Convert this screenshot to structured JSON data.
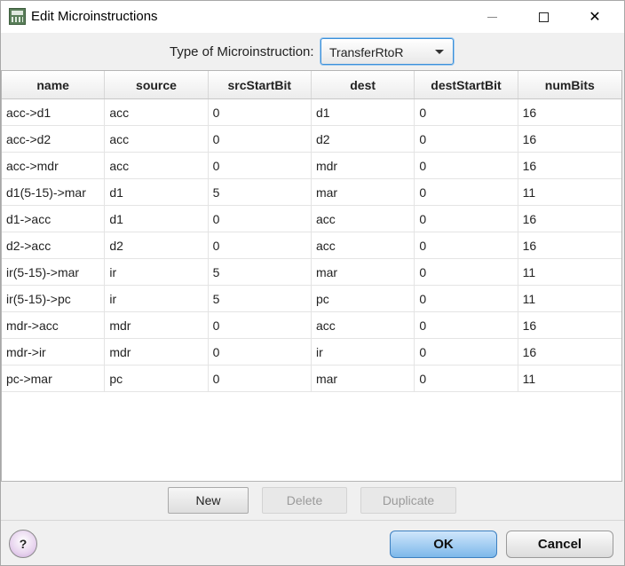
{
  "window": {
    "title": "Edit Microinstructions",
    "minimize_glyph": "",
    "close_glyph": "✕"
  },
  "type_selector": {
    "label": "Type of Microinstruction:",
    "value": "TransferRtoR"
  },
  "table": {
    "columns": [
      "name",
      "source",
      "srcStartBit",
      "dest",
      "destStartBit",
      "numBits"
    ],
    "rows": [
      [
        "acc->d1",
        "acc",
        "0",
        "d1",
        "0",
        "16"
      ],
      [
        "acc->d2",
        "acc",
        "0",
        "d2",
        "0",
        "16"
      ],
      [
        "acc->mdr",
        "acc",
        "0",
        "mdr",
        "0",
        "16"
      ],
      [
        "d1(5-15)->mar",
        "d1",
        "5",
        "mar",
        "0",
        "11"
      ],
      [
        "d1->acc",
        "d1",
        "0",
        "acc",
        "0",
        "16"
      ],
      [
        "d2->acc",
        "d2",
        "0",
        "acc",
        "0",
        "16"
      ],
      [
        "ir(5-15)->mar",
        "ir",
        "5",
        "mar",
        "0",
        "11"
      ],
      [
        "ir(5-15)->pc",
        "ir",
        "5",
        "pc",
        "0",
        "11"
      ],
      [
        "mdr->acc",
        "mdr",
        "0",
        "acc",
        "0",
        "16"
      ],
      [
        "mdr->ir",
        "mdr",
        "0",
        "ir",
        "0",
        "16"
      ],
      [
        "pc->mar",
        "pc",
        "0",
        "mar",
        "0",
        "11"
      ]
    ]
  },
  "actions": {
    "new_label": "New",
    "delete_label": "Delete",
    "duplicate_label": "Duplicate"
  },
  "footer": {
    "help_label": "?",
    "ok_label": "OK",
    "cancel_label": "Cancel"
  },
  "colors": {
    "accent": "#3b8fd8",
    "ok_button": "#7db8ea"
  }
}
